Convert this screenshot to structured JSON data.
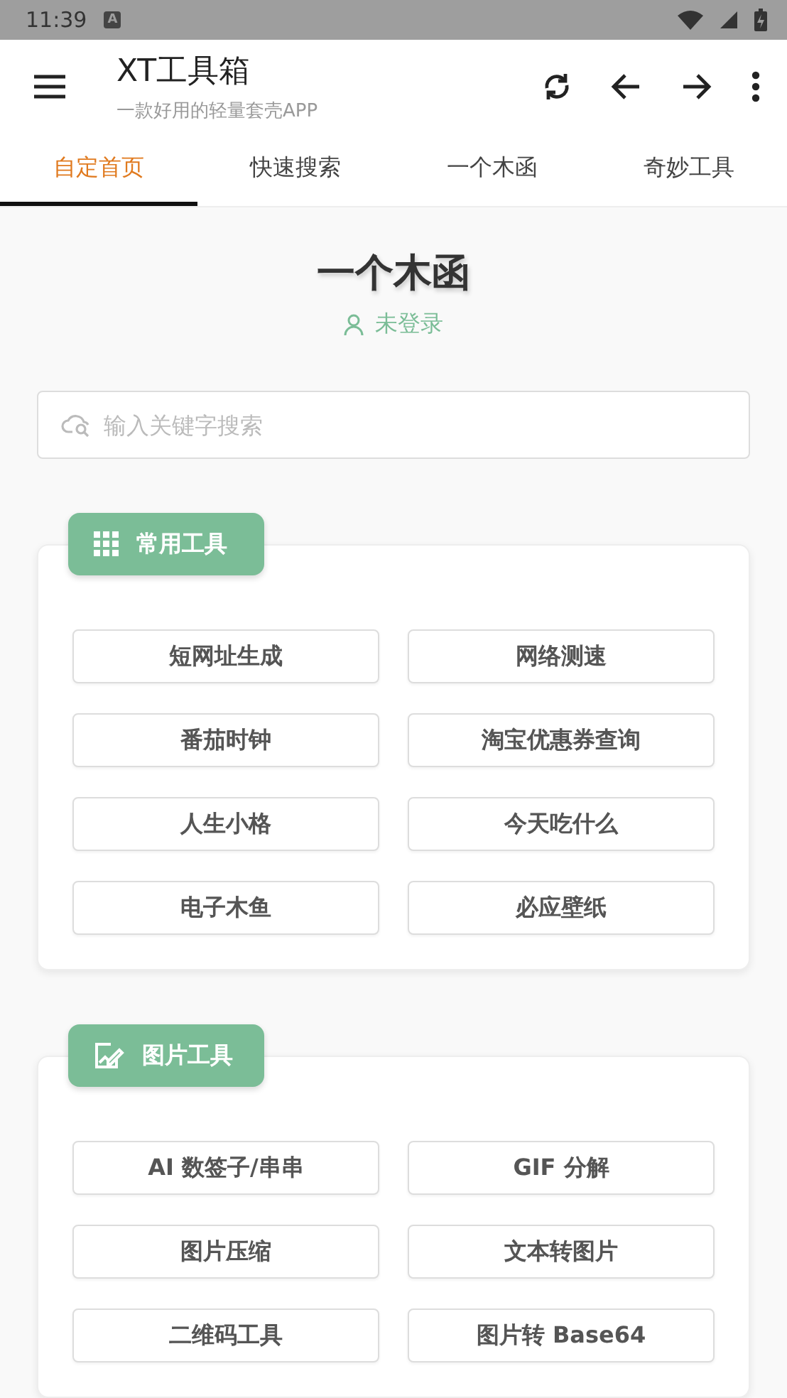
{
  "status_bar": {
    "time": "11:39",
    "notification": "A"
  },
  "app_bar": {
    "title": "XT工具箱",
    "subtitle": "一款好用的轻量套壳APP"
  },
  "tabs": [
    {
      "label": "自定首页",
      "selected": true
    },
    {
      "label": "快速搜索",
      "selected": false
    },
    {
      "label": "一个木函",
      "selected": false
    },
    {
      "label": "奇妙工具",
      "selected": false
    }
  ],
  "header": {
    "title": "一个木函",
    "login": "未登录"
  },
  "search": {
    "placeholder": "输入关键字搜索"
  },
  "sections": [
    {
      "title": "常用工具",
      "kind": "grid",
      "tools": [
        "短网址生成",
        "网络测速",
        "番茄时钟",
        "淘宝优惠券查询",
        "人生小格",
        "今天吃什么",
        "电子木鱼",
        "必应壁纸"
      ]
    },
    {
      "title": "图片工具",
      "kind": "image-edit",
      "tools": [
        "AI 数签子/串串",
        "GIF 分解",
        "图片压缩",
        "文本转图片",
        "二维码工具",
        "图片转 Base64"
      ]
    }
  ]
}
